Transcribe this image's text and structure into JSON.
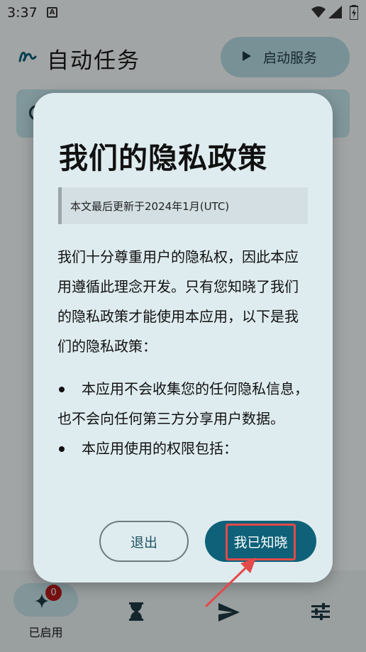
{
  "status_bar": {
    "time": "3:37",
    "notif": "A"
  },
  "app": {
    "title": "自动任务",
    "start_button_label": "启动服务"
  },
  "dialog": {
    "title": "我们的隐私政策",
    "updated": "本文最后更新于2024年1月(UTC)",
    "intro": "我们十分尊重用户的隐私权，因此本应用遵循此理念开发。只有您知晓了我们的隐私政策才能使用本应用，以下是我们的隐私政策：",
    "bullets": [
      "本应用不会收集您的任何隐私信息，也不会向任何第三方分享用户数据。",
      "本应用使用的权限包括："
    ],
    "exit_label": "退出",
    "accept_label": "我已知晓"
  },
  "bottom_nav": {
    "items": [
      {
        "label": "已启用",
        "badge": "0",
        "icon": "sparkle-icon"
      },
      {
        "label": "",
        "icon": "hourglass-icon"
      },
      {
        "label": "",
        "icon": "send-icon"
      },
      {
        "label": "",
        "icon": "tune-icon"
      }
    ]
  },
  "colors": {
    "accent": "#0e6178",
    "highlight": "#e34a4a",
    "dialog_bg": "#dfecef"
  }
}
